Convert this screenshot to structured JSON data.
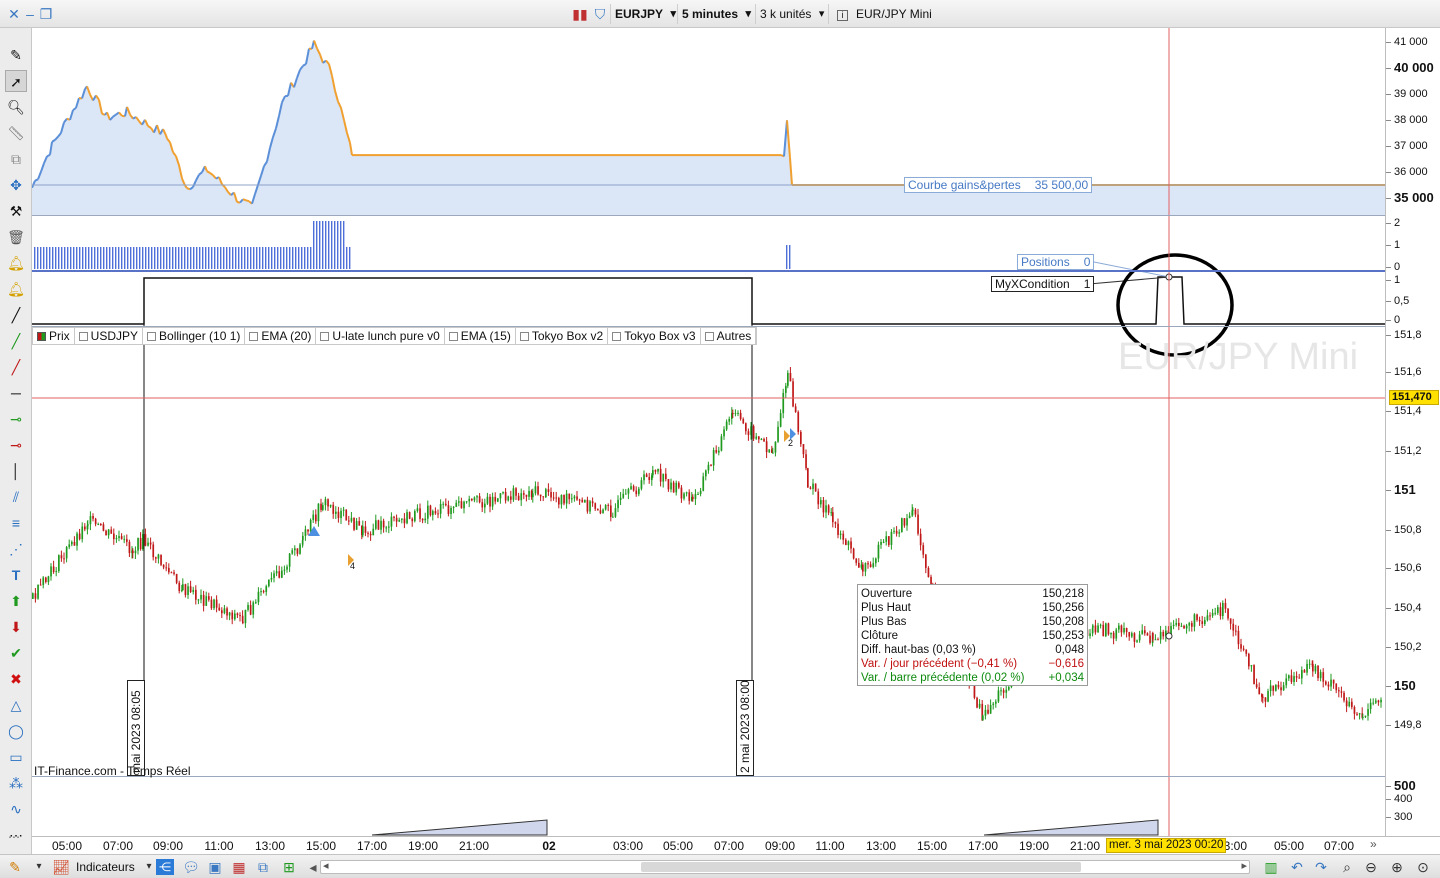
{
  "toolbar": {
    "symbol": "EURJPY",
    "timeframe": "5 minutes",
    "units": "3 k unités",
    "instrument": "EUR/JPY Mini"
  },
  "equity_panel": {
    "axis_labels": [
      "41 000",
      "40 000",
      "39 000",
      "38 000",
      "37 000",
      "36 000",
      "35 000"
    ],
    "tag_name": "Courbe gains&pertes",
    "tag_value": "35 500,00"
  },
  "positions_panel": {
    "axis_labels": [
      "2",
      "1",
      "0"
    ],
    "tag_name": "Positions",
    "tag_value": "0"
  },
  "condition_panel": {
    "axis_labels": [
      "1",
      "0,5",
      "0"
    ],
    "tag_name": "MyXCondition",
    "tag_value": "1"
  },
  "price_panel": {
    "legend": [
      {
        "label": "Prix",
        "checked": true
      },
      {
        "label": "USDJPY",
        "checked": false
      },
      {
        "label": "Bollinger (10 1)",
        "checked": false
      },
      {
        "label": "EMA (20)",
        "checked": false
      },
      {
        "label": "U-late lunch pure v0",
        "checked": false
      },
      {
        "label": "EMA (15)",
        "checked": false
      },
      {
        "label": "Tokyo Box v2",
        "checked": false
      },
      {
        "label": "Tokyo Box v3",
        "checked": false
      },
      {
        "label": "Autres",
        "checked": false
      }
    ],
    "axis_labels": [
      "151,8",
      "151,6",
      "151,4",
      "151,2",
      "151",
      "150,8",
      "150,6",
      "150,4",
      "150,2",
      "150",
      "149,8"
    ],
    "current_price": "151,470",
    "watermark": "EUR/JPY Mini",
    "source": "IT-Finance.com - Temps Réel",
    "vline_label_1": "mai 2023 08:05",
    "vline_label_2": "2 mai 2023 08:00",
    "trade_marker_1": "4",
    "trade_marker_2": "2"
  },
  "ohlc_tooltip": {
    "rows": [
      {
        "label": "Ouverture",
        "value": "150,218",
        "tone": ""
      },
      {
        "label": "Plus Haut",
        "value": "150,256",
        "tone": ""
      },
      {
        "label": "Plus Bas",
        "value": "150,208",
        "tone": ""
      },
      {
        "label": "Clôture",
        "value": "150,253",
        "tone": ""
      },
      {
        "label": "Diff. haut-bas (0,03 %)",
        "value": "0,048",
        "tone": ""
      },
      {
        "label": "Var. / jour précédent (−0,41 %)",
        "value": "−0,616",
        "tone": "red"
      },
      {
        "label": "Var. / barre précédente (0,02 %)",
        "value": "+0,034",
        "tone": "grn"
      }
    ]
  },
  "volume_panel": {
    "axis_labels": [
      "500",
      "400",
      "300"
    ]
  },
  "xaxis": {
    "labels": [
      "05:00",
      "07:00",
      "09:00",
      "11:00",
      "13:00",
      "15:00",
      "17:00",
      "19:00",
      "21:00",
      "02",
      "03:00",
      "05:00",
      "07:00",
      "09:00",
      "11:00",
      "13:00",
      "15:00",
      "17:00",
      "19:00",
      "21:00",
      "03:00",
      "05:00",
      "07:00"
    ],
    "cursor_label": "mer. 3 mai 2023 00:20"
  },
  "bottombar": {
    "indicators_label": "Indicateurs"
  },
  "colors": {
    "equity_line": "#f0a030",
    "equity_line_up": "#5b8fd8",
    "equity_fill": "#dbe6f7",
    "candle_up": "#1f9a1f",
    "candle_down": "#c01818",
    "crosshair": "#e06060",
    "position_bar": "#4f6fd8"
  }
}
